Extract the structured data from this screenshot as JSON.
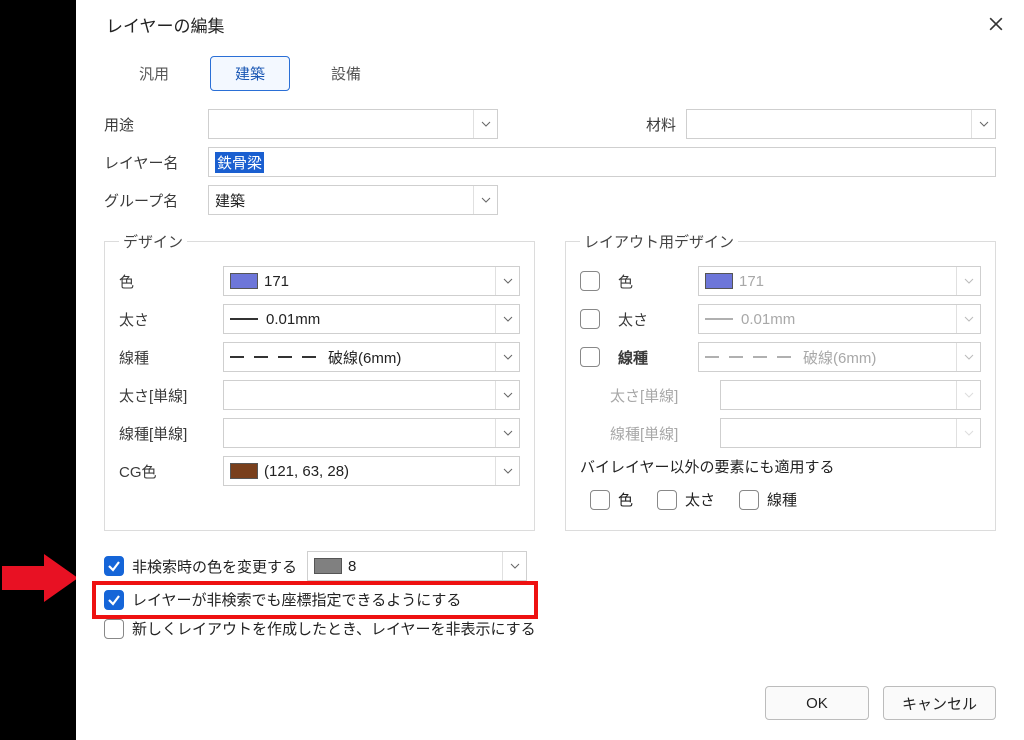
{
  "dialog": {
    "title": "レイヤーの編集"
  },
  "tabs": {
    "general": "汎用",
    "arch": "建築",
    "equip": "設備"
  },
  "labels": {
    "use": "用途",
    "material": "材料",
    "layer_name": "レイヤー名",
    "group_name": "グループ名",
    "design_title": "デザイン",
    "layout_design_title": "レイアウト用デザイン",
    "color": "色",
    "thickness": "太さ",
    "linetype": "線種",
    "thick_single": "太さ[単線]",
    "linetype_single": "線種[単線]",
    "cg_color": "CG色",
    "apply_other": "バイレイヤー以外の要素にも適用する"
  },
  "values": {
    "use": "",
    "material": "",
    "layer_name": "鉄骨梁",
    "group_name": "建築",
    "color_code": "171",
    "color_hex": "#6d76d9",
    "thickness": "0.01mm",
    "linetype": "破線(6mm)",
    "thick_single": "",
    "linetype_single": "",
    "cg_color_text": "(121, 63, 28)",
    "cg_color_hex": "#793f1c",
    "layout_color_code": "171",
    "layout_color_hex": "#6d76d9",
    "layout_thickness": "0.01mm",
    "layout_linetype": "破線(6mm)",
    "nonsearch_color_num": "8",
    "nonsearch_color_hex": "#808080"
  },
  "checks": {
    "layout_color": false,
    "layout_thickness": false,
    "layout_linetype": false,
    "apply_color": false,
    "apply_thickness": false,
    "apply_linetype": false,
    "change_nonsearch_color": true,
    "coord_on_nonsearch": true,
    "hide_on_new_layout": false
  },
  "options": {
    "change_nonsearch_color": "非検索時の色を変更する",
    "coord_on_nonsearch": "レイヤーが非検索でも座標指定できるようにする",
    "hide_on_new_layout": "新しくレイアウトを作成したとき、レイヤーを非表示にする"
  },
  "buttons": {
    "ok": "OK",
    "cancel": "キャンセル"
  }
}
